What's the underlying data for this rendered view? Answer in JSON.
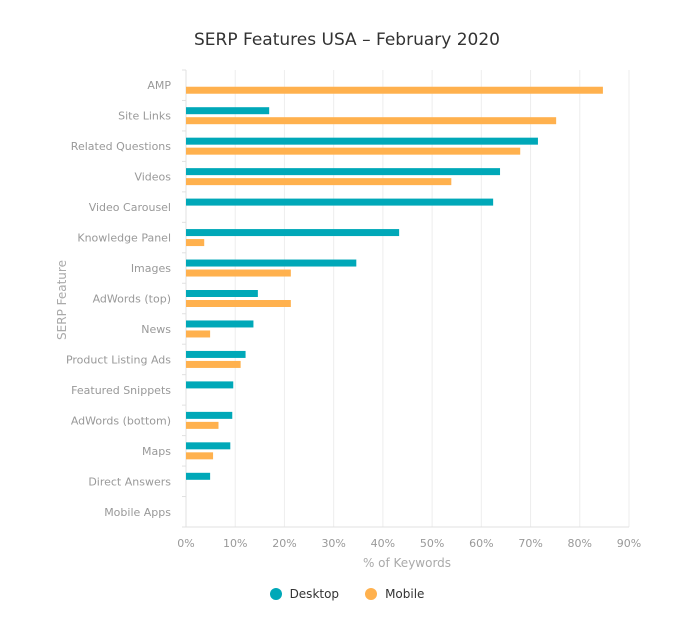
{
  "chart_data": {
    "type": "bar",
    "orientation": "horizontal",
    "title": "SERP Features USA – February 2020",
    "xlabel": "% of Keywords",
    "ylabel": "SERP Feature",
    "xlim": [
      0,
      90
    ],
    "x_ticks": [
      "0%",
      "10%",
      "20%",
      "30%",
      "40%",
      "50%",
      "60%",
      "70%",
      "80%",
      "90%"
    ],
    "grid": true,
    "legend_position": "bottom-center",
    "categories": [
      "AMP",
      "Site Links",
      "Related Questions",
      "Videos",
      "Video Carousel",
      "Knowledge Panel",
      "Images",
      "AdWords (top)",
      "News",
      "Product Listing Ads",
      "Featured Snippets",
      "AdWords (bottom)",
      "Maps",
      "Direct Answers",
      "Mobile Apps"
    ],
    "series": [
      {
        "name": "Desktop",
        "color": "#00A8B8",
        "values": [
          0,
          16.9,
          71.5,
          63.8,
          62.4,
          43.3,
          34.6,
          14.6,
          13.7,
          12.1,
          9.6,
          9.4,
          9.0,
          4.9,
          0
        ]
      },
      {
        "name": "Mobile",
        "color": "#FFB14E",
        "values": [
          84.7,
          75.2,
          67.9,
          53.9,
          0,
          3.7,
          21.3,
          21.3,
          4.9,
          11.1,
          0,
          6.6,
          5.5,
          0,
          0
        ]
      }
    ]
  }
}
